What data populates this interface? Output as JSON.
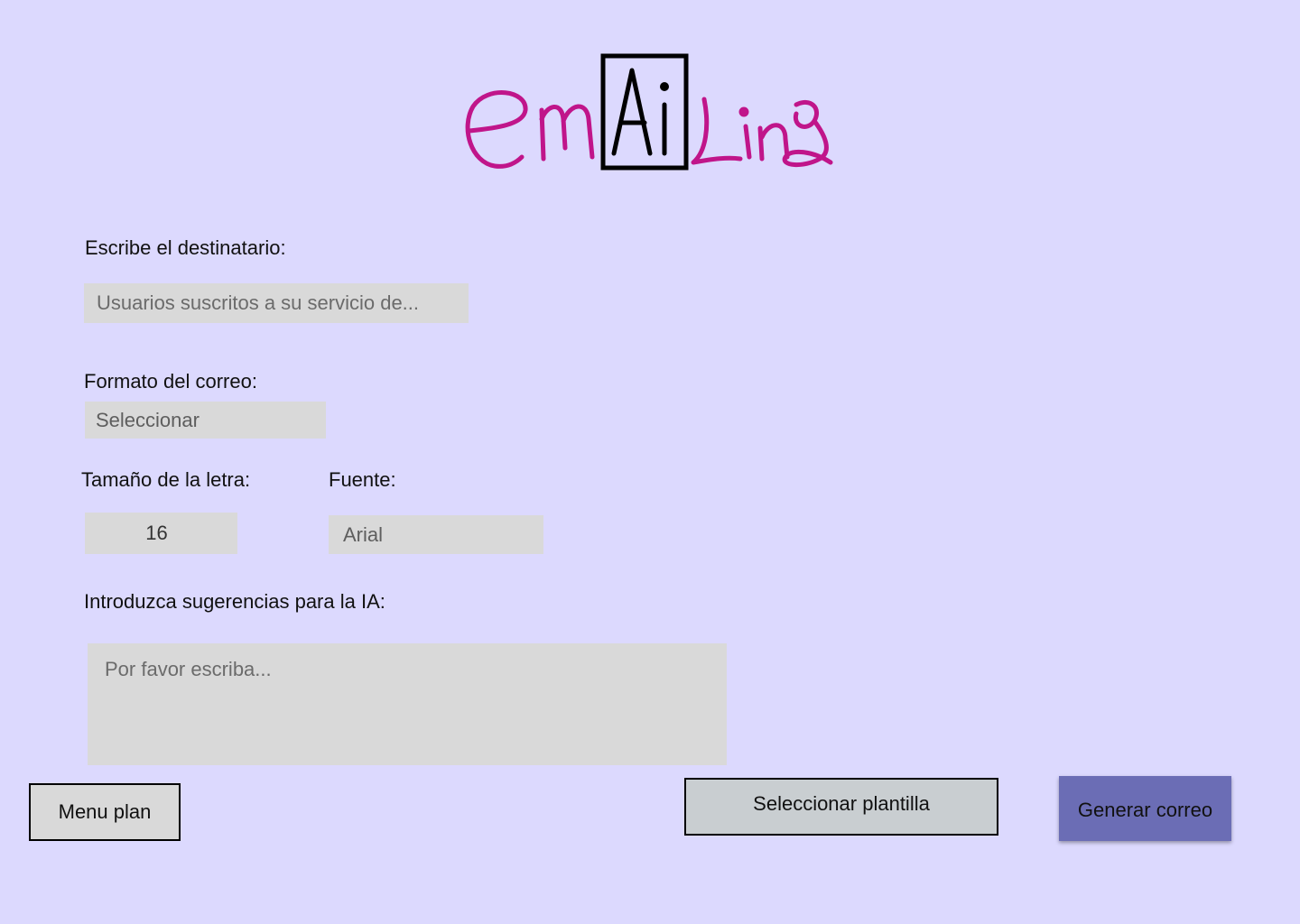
{
  "logo": {
    "text_em": "em",
    "text_ai": "Ai",
    "text_ling": "Ling",
    "color": "#c0158a"
  },
  "form": {
    "recipient": {
      "label": "Escribe el destinatario:",
      "placeholder": "Usuarios suscritos a su servicio de..."
    },
    "format": {
      "label": "Formato del correo:",
      "value": "Seleccionar"
    },
    "font_size": {
      "label": "Tamaño de la letra:",
      "value": "16"
    },
    "font": {
      "label": "Fuente:",
      "value": "Arial"
    },
    "suggestions": {
      "label": "Introduzca sugerencias para la IA:",
      "placeholder": "Por favor escriba..."
    }
  },
  "buttons": {
    "menu_plan": "Menu plan",
    "select_template": "Seleccionar plantilla",
    "generate": "Generar correo"
  },
  "colors": {
    "background": "#dcd9fe",
    "field": "#d9d9d9",
    "primary_button": "#6b6db5",
    "secondary_button": "#c9ced1",
    "menu_button": "#d9d9d9"
  }
}
